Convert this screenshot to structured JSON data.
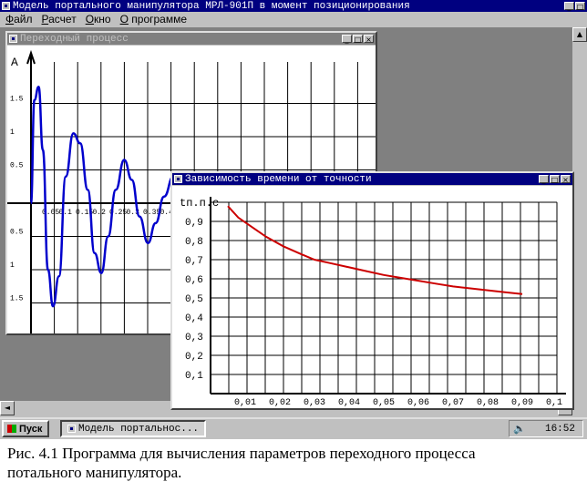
{
  "app": {
    "title": "Модель портального манипулятора МРЛ-901П в момент позиционирования",
    "menu": [
      "Файл",
      "Расчет",
      "Окно",
      "О программе"
    ]
  },
  "window1": {
    "title": "Переходный процесс",
    "y_axis_label": "A",
    "y_ticks": [
      "1.5",
      "1",
      "0.5",
      "0.5",
      "1",
      "1.5"
    ],
    "x_ticks": [
      "0.05",
      "0.1",
      "0.15",
      "0.2",
      "0.25",
      "0.3",
      "0.35",
      "0.4"
    ]
  },
  "window2": {
    "title": "Зависимость времени от точности",
    "y_axis_label": "tп.п.с"
  },
  "taskbar": {
    "start_label": "Пуск",
    "task_label": "Модель портальнос...",
    "clock": "16:52"
  },
  "caption": {
    "line1": "Рис. 4.1 Программа для вычисления параметров переходного процесса",
    "line2": "потального манипулятора."
  },
  "chart_data": [
    {
      "type": "line",
      "title": "Переходный процесс",
      "ylabel": "A",
      "xlabel": "",
      "x_tick_labels": [
        "0.05",
        "0.1",
        "0.15",
        "0.2",
        "0.25",
        "0.3",
        "0.35",
        "0.4"
      ],
      "ylim": [
        -1.8,
        1.8
      ],
      "grid": true,
      "series": [
        {
          "values": [
            [
              0.0,
              0.0
            ],
            [
              0.004,
              1.55
            ],
            [
              0.009,
              1.75
            ],
            [
              0.014,
              0.8
            ],
            [
              0.02,
              -1.0
            ],
            [
              0.026,
              -1.55
            ],
            [
              0.033,
              -1.1
            ],
            [
              0.041,
              0.4
            ],
            [
              0.05,
              1.05
            ],
            [
              0.058,
              0.9
            ],
            [
              0.067,
              0.2
            ],
            [
              0.075,
              -0.75
            ],
            [
              0.083,
              -1.05
            ],
            [
              0.091,
              -0.5
            ],
            [
              0.1,
              0.2
            ],
            [
              0.11,
              0.65
            ],
            [
              0.119,
              0.35
            ],
            [
              0.128,
              -0.2
            ],
            [
              0.138,
              -0.6
            ],
            [
              0.147,
              -0.3
            ],
            [
              0.157,
              0.1
            ],
            [
              0.168,
              0.4
            ],
            [
              0.178,
              0.25
            ],
            [
              0.19,
              -0.05
            ],
            [
              0.201,
              -0.3
            ],
            [
              0.213,
              -0.1
            ],
            [
              0.225,
              0.05
            ],
            [
              0.24,
              0.15
            ],
            [
              0.255,
              0.1
            ],
            [
              0.27,
              -0.05
            ],
            [
              0.29,
              -0.1
            ],
            [
              0.31,
              0.0
            ],
            [
              0.33,
              0.05
            ],
            [
              0.35,
              0.0
            ],
            [
              0.37,
              -0.03
            ],
            [
              0.39,
              0.02
            ],
            [
              0.41,
              0.0
            ]
          ]
        }
      ]
    },
    {
      "type": "line",
      "title": "Зависимость времени от точности",
      "ylabel": "tп.п.с",
      "xlabel": "",
      "x_tick_labels": [
        "0,01",
        "0,02",
        "0,03",
        "0,04",
        "0,05",
        "0,06",
        "0,07",
        "0,08",
        "0,09",
        "0,1"
      ],
      "y_tick_labels": [
        "0,9",
        "0,8",
        "0,7",
        "0,6",
        "0,5",
        "0,4",
        "0,3",
        "0,2",
        "0,1"
      ],
      "xlim": [
        0,
        0.1
      ],
      "ylim": [
        0,
        1.0
      ],
      "grid": true,
      "series": [
        {
          "color": "#cc0000",
          "values": [
            [
              0.005,
              0.98
            ],
            [
              0.008,
              0.92
            ],
            [
              0.012,
              0.87
            ],
            [
              0.016,
              0.82
            ],
            [
              0.021,
              0.77
            ],
            [
              0.026,
              0.73
            ],
            [
              0.03,
              0.7
            ],
            [
              0.035,
              0.68
            ],
            [
              0.04,
              0.66
            ],
            [
              0.045,
              0.64
            ],
            [
              0.05,
              0.62
            ],
            [
              0.055,
              0.605
            ],
            [
              0.06,
              0.59
            ],
            [
              0.065,
              0.575
            ],
            [
              0.07,
              0.56
            ],
            [
              0.075,
              0.55
            ],
            [
              0.08,
              0.54
            ],
            [
              0.085,
              0.53
            ],
            [
              0.09,
              0.52
            ]
          ]
        }
      ]
    }
  ]
}
